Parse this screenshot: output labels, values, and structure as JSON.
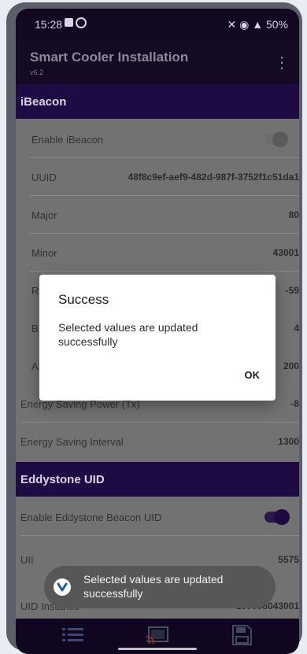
{
  "status_bar": {
    "time": "15:28",
    "signal_text": "50%"
  },
  "app_bar": {
    "title": "Smart Cooler Installation",
    "version": "v6.2"
  },
  "sections": {
    "ibeacon": "iBeacon",
    "eddystone": "Eddystone UID"
  },
  "ibeacon_rows": {
    "enable": {
      "label": "Enable iBeacon",
      "enabled": false
    },
    "uuid": {
      "label": "UUID",
      "value": "48f8c9ef-aef9-482d-987f-3752f1c51da1"
    },
    "major": {
      "label": "Major",
      "value": "80"
    },
    "minor": {
      "label": "Minor",
      "value": "43001"
    },
    "hidden_row_1": {
      "label": "R",
      "value": "-59"
    },
    "hidden_row_2": {
      "label": "B",
      "value": "4"
    },
    "hidden_row_3": {
      "label": "A",
      "value": "200"
    },
    "energy_power": {
      "label": "Energy Saving Power (Tx)",
      "value": "-8"
    },
    "energy_interval": {
      "label": "Energy Saving Interval",
      "value": "1300"
    }
  },
  "eddystone_rows": {
    "enable": {
      "label": "Enable Eddystone Beacon UID",
      "enabled": true
    },
    "namespace": {
      "label": "UII",
      "value": "5575"
    },
    "instance": {
      "label": "UID Instance",
      "value": "100008043001"
    }
  },
  "dialog": {
    "title": "Success",
    "message": "Selected values are updated successfully",
    "ok_label": "OK"
  },
  "toast": {
    "message": "Selected values are updated successfully"
  },
  "bottom_bar": {
    "icons": [
      "list-icon",
      "cast-icon",
      "save-icon"
    ]
  },
  "colors": {
    "header": "#1f0b44",
    "dim_background": "#727272",
    "dialog": "#ffffff"
  }
}
